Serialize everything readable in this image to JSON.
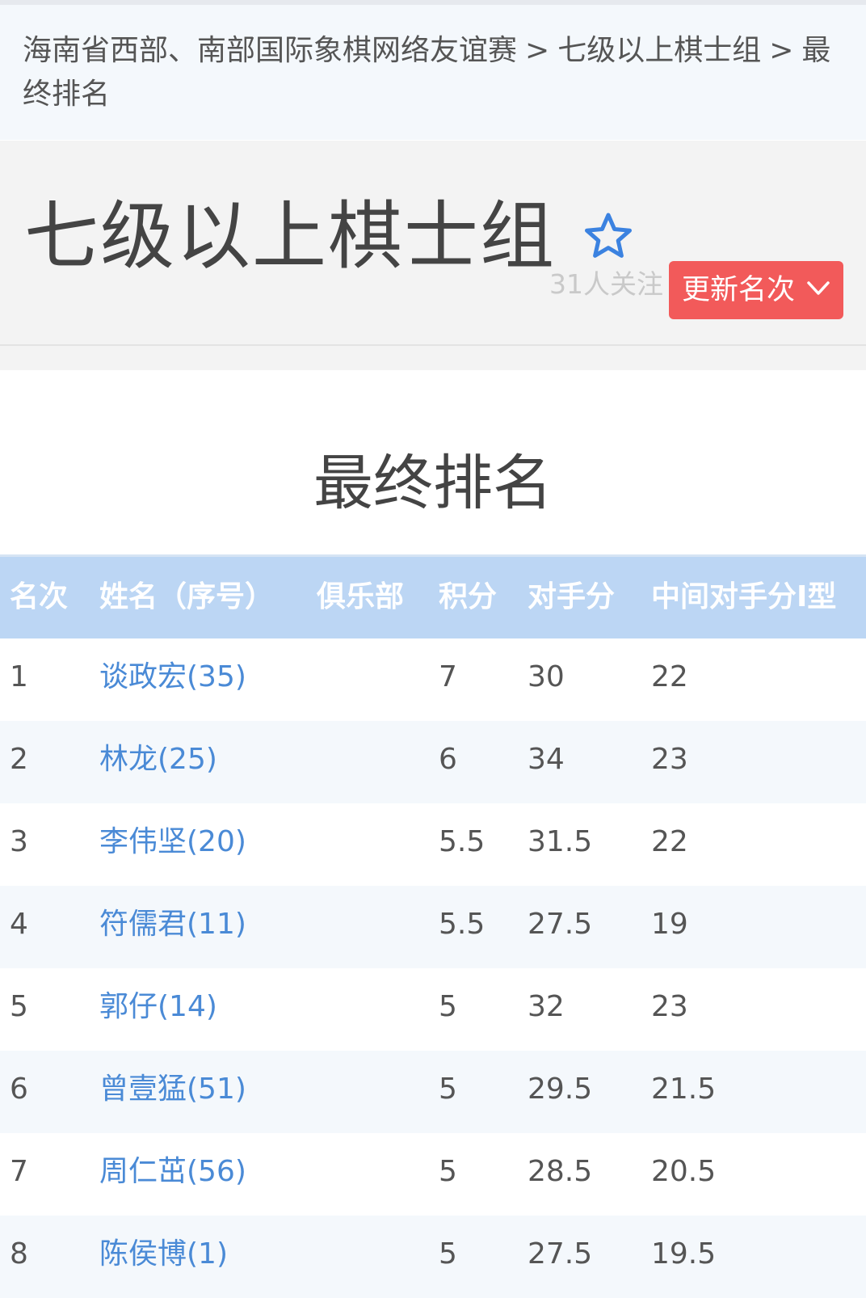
{
  "breadcrumb": {
    "level1": "海南省西部、南部国际象棋网络友谊赛",
    "separator": ">",
    "level2": "七级以上棋士组",
    "level3": "最终排名"
  },
  "header": {
    "group_title": "七级以上棋士组",
    "star_icon": "star-outline-icon",
    "follow_count": "31人关注",
    "update_button_label": "更新名次",
    "update_button_icon": "chevron-down-icon"
  },
  "section": {
    "title": "最终排名"
  },
  "table": {
    "columns": {
      "rank": "名次",
      "name": "姓名（序号）",
      "club": "俱乐部",
      "score": "积分",
      "opponent_score": "对手分",
      "median_opponent": "中间对手分I型"
    },
    "rows": [
      {
        "rank": "1",
        "name": "谈政宏(35)",
        "club": "",
        "score": "7",
        "opponent_score": "30",
        "median_opponent": "22"
      },
      {
        "rank": "2",
        "name": "林龙(25)",
        "club": "",
        "score": "6",
        "opponent_score": "34",
        "median_opponent": "23"
      },
      {
        "rank": "3",
        "name": "李伟坚(20)",
        "club": "",
        "score": "5.5",
        "opponent_score": "31.5",
        "median_opponent": "22"
      },
      {
        "rank": "4",
        "name": "符儒君(11)",
        "club": "",
        "score": "5.5",
        "opponent_score": "27.5",
        "median_opponent": "19"
      },
      {
        "rank": "5",
        "name": "郭仔(14)",
        "club": "",
        "score": "5",
        "opponent_score": "32",
        "median_opponent": "23"
      },
      {
        "rank": "6",
        "name": "曾壹猛(51)",
        "club": "",
        "score": "5",
        "opponent_score": "29.5",
        "median_opponent": "21.5"
      },
      {
        "rank": "7",
        "name": "周仁茁(56)",
        "club": "",
        "score": "5",
        "opponent_score": "28.5",
        "median_opponent": "20.5"
      },
      {
        "rank": "8",
        "name": "陈侯博(1)",
        "club": "",
        "score": "5",
        "opponent_score": "27.5",
        "median_opponent": "19.5"
      }
    ]
  },
  "colors": {
    "header_blue": "#bcd6f4",
    "link_blue": "#4a8ad6",
    "button_red": "#f25a5a",
    "star_blue": "#3b82e0"
  }
}
